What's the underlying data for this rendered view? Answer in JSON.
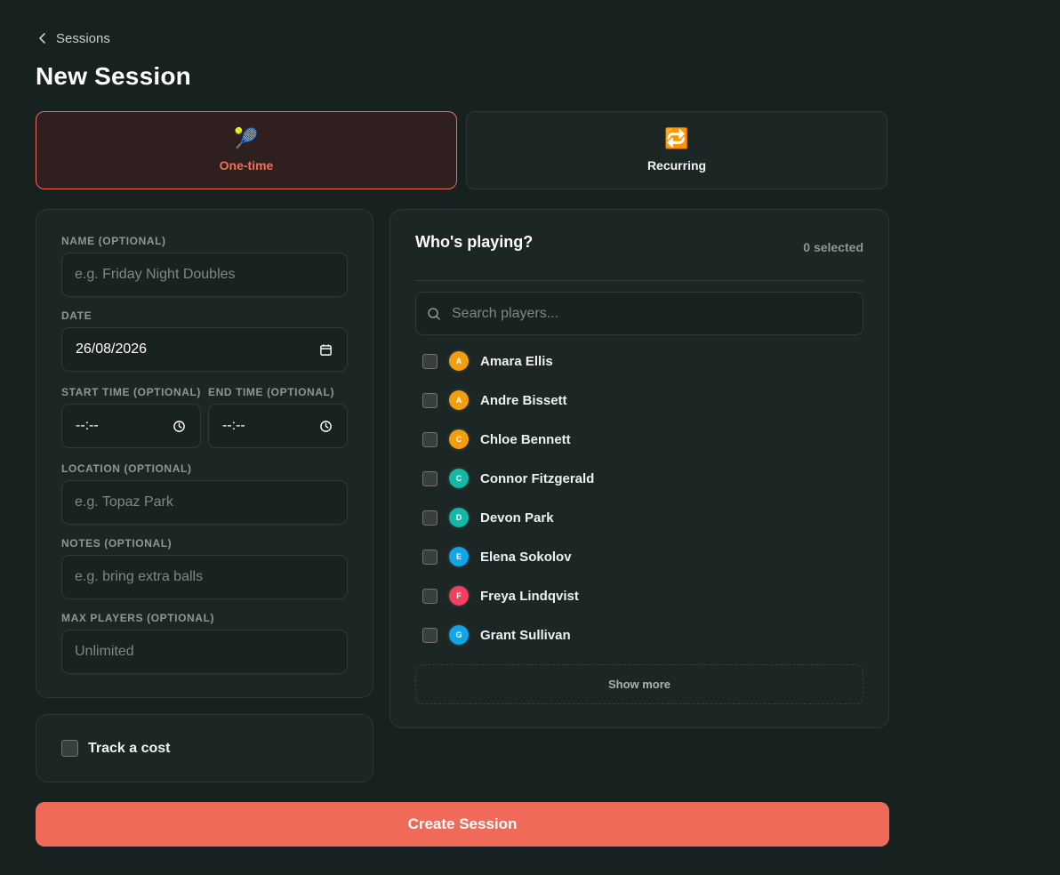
{
  "breadcrumb": {
    "back_label": "Sessions"
  },
  "page": {
    "title": "New Session"
  },
  "session_types": [
    {
      "label": "One-time",
      "emoji": "🎾",
      "selected": true
    },
    {
      "label": "Recurring",
      "emoji": "🔁",
      "selected": false
    }
  ],
  "form": {
    "name": {
      "label": "NAME (OPTIONAL)",
      "placeholder": "e.g. Friday Night Doubles",
      "value": ""
    },
    "date": {
      "label": "DATE",
      "value": "26/08/2026"
    },
    "start_time": {
      "label": "START TIME (OPTIONAL)",
      "value": "--:--"
    },
    "end_time": {
      "label": "END TIME (OPTIONAL)",
      "value": "--:--"
    },
    "location": {
      "label": "LOCATION (OPTIONAL)",
      "placeholder": "e.g. Topaz Park",
      "value": ""
    },
    "notes": {
      "label": "NOTES (OPTIONAL)",
      "placeholder": "e.g. bring extra balls",
      "value": ""
    },
    "max_players": {
      "label": "MAX PLAYERS (OPTIONAL)",
      "placeholder": "Unlimited",
      "value": ""
    }
  },
  "players": {
    "title": "Who's playing?",
    "selected_count": "0 selected",
    "search_placeholder": "Search players...",
    "show_more_label": "Show more",
    "list": [
      {
        "initial": "A",
        "name": "Amara Ellis",
        "color": "#f59e0b",
        "checked": false
      },
      {
        "initial": "A",
        "name": "Andre Bissett",
        "color": "#f59e0b",
        "checked": false
      },
      {
        "initial": "C",
        "name": "Chloe Bennett",
        "color": "#f59e0b",
        "checked": false
      },
      {
        "initial": "C",
        "name": "Connor Fitzgerald",
        "color": "#14b8a6",
        "checked": false
      },
      {
        "initial": "D",
        "name": "Devon Park",
        "color": "#14b8a6",
        "checked": false
      },
      {
        "initial": "E",
        "name": "Elena Sokolov",
        "color": "#0ea5e9",
        "checked": false
      },
      {
        "initial": "F",
        "name": "Freya Lindqvist",
        "color": "#f43f5e",
        "checked": false
      },
      {
        "initial": "G",
        "name": "Grant Sullivan",
        "color": "#0ea5e9",
        "checked": false
      }
    ]
  },
  "cost": {
    "label": "Track a cost",
    "checked": false
  },
  "actions": {
    "create_label": "Create Session"
  },
  "theme": {
    "accent": "#ef6a58",
    "background": "#162120",
    "panel": "#1b2625"
  }
}
